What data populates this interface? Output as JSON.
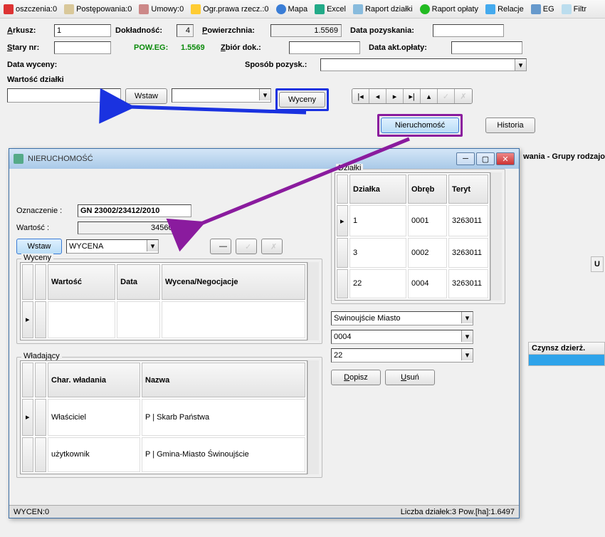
{
  "toolbar": {
    "oszczenia": "oszczenia:0",
    "postepowania": "Postępowania:0",
    "umowy": "Umowy:0",
    "ogr": "Ogr.prawa rzecz.:0",
    "mapa": "Mapa",
    "excel": "Excel",
    "raport_dzialki": "Raport działki",
    "raport_oplaty": "Raport opłaty",
    "relacje": "Relacje",
    "eg": "EG",
    "filtr": "Filtr"
  },
  "form": {
    "arkusz_lbl": "Arkusz:",
    "arkusz_val": "1",
    "dokladnosc_lbl": "Dokładność:",
    "dokladnosc_val": "4",
    "powierzchnia_lbl": "Powierzchnia:",
    "powierzchnia_val": "1.5569",
    "data_pozyskania_lbl": "Data pozyskania:",
    "data_pozyskania_val": "",
    "stary_nr_lbl": "Stary nr:",
    "stary_nr_val": "",
    "pow_eg_lbl": "POW.EG:",
    "pow_eg_val": "1.5569",
    "zbior_dok_lbl": "Zbiór dok.:",
    "zbior_dok_val": "",
    "data_akt_lbl": "Data akt.opłaty:",
    "data_akt_val": "",
    "data_wyceny_lbl": "Data wyceny:",
    "sposob_pozysk_lbl": "Sposób pozysk.:",
    "wartosc_dzialki_lbl": "Wartość działki",
    "wstaw_btn": "Wstaw",
    "wyceny_btn": "Wyceny",
    "nieruchomosc_btn": "Nieruchomość",
    "historia_btn": "Historia",
    "wania_lbl": "wania - Grupy rodzajo"
  },
  "dialog": {
    "title": "NIERUCHOMOŚĆ",
    "oznaczenie_lbl": "Oznaczenie :",
    "oznaczenie_val": "GN 23002/23412/2010",
    "wartosc_lbl": "Wartość :",
    "wartosc_val": "345600.00",
    "wstaw_btn": "Wstaw",
    "wycena_opt": "WYCENA",
    "wyceny_group": "Wyceny",
    "wyceny_cols": [
      "Wartość",
      "Data",
      "Wycena/Negocjacje"
    ],
    "wladajacy_group": "Władający",
    "wladajacy_cols": [
      "Char. władania",
      "Nazwa"
    ],
    "wladajacy_rows": [
      {
        "char": "Właściciel",
        "nazwa": "P | Skarb Państwa"
      },
      {
        "char": "użytkownik",
        "nazwa": "P | Gmina-Miasto Świnoujście"
      }
    ],
    "dzialki_group": "Działki",
    "dzialki_cols": [
      "Działka",
      "Obręb",
      "Teryt"
    ],
    "dzialki_rows": [
      {
        "d": "1",
        "o": "0001",
        "t": "3263011"
      },
      {
        "d": "3",
        "o": "0002",
        "t": "3263011"
      },
      {
        "d": "22",
        "o": "0004",
        "t": "3263011"
      }
    ],
    "combo1": "Świnoujście Miasto",
    "combo2": "0004",
    "combo3": "22",
    "dopisz_btn": "Dopisz",
    "usun_btn": "Usuń",
    "status": "WYCEN:0",
    "status2": "Liczba działek:3  Pow.[ha]:1.6497"
  },
  "side": {
    "u_lbl": "U",
    "czynsz": "Czynsz dzierż."
  }
}
